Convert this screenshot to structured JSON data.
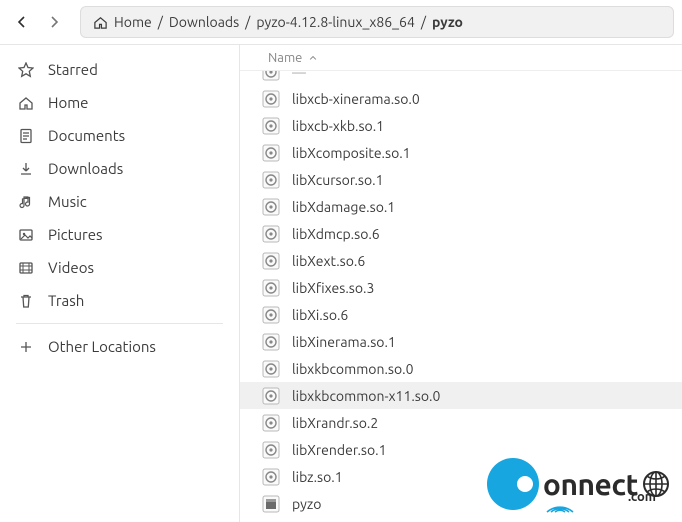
{
  "breadcrumb": {
    "home": "Home",
    "seg1": "Downloads",
    "seg2": "pyzo-4.12.8-linux_x86_64",
    "seg3": "pyzo"
  },
  "sidebar": {
    "starred": "Starred",
    "home": "Home",
    "documents": "Documents",
    "downloads": "Downloads",
    "music": "Music",
    "pictures": "Pictures",
    "videos": "Videos",
    "trash": "Trash",
    "other": "Other Locations"
  },
  "columns": {
    "name": "Name"
  },
  "files": [
    {
      "name": "libxcb-xinerama.so.0"
    },
    {
      "name": "libxcb-xkb.so.1"
    },
    {
      "name": "libXcomposite.so.1"
    },
    {
      "name": "libXcursor.so.1"
    },
    {
      "name": "libXdamage.so.1"
    },
    {
      "name": "libXdmcp.so.6"
    },
    {
      "name": "libXext.so.6"
    },
    {
      "name": "libXfixes.so.3"
    },
    {
      "name": "libXi.so.6"
    },
    {
      "name": "libXinerama.so.1"
    },
    {
      "name": "libxkbcommon.so.0"
    },
    {
      "name": "libxkbcommon-x11.so.0",
      "selected": true
    },
    {
      "name": "libXrandr.so.2"
    },
    {
      "name": "libXrender.so.1"
    },
    {
      "name": "libz.so.1"
    },
    {
      "name": "pyzo"
    }
  ],
  "watermark": {
    "text": "onnect",
    "com": ".com"
  }
}
